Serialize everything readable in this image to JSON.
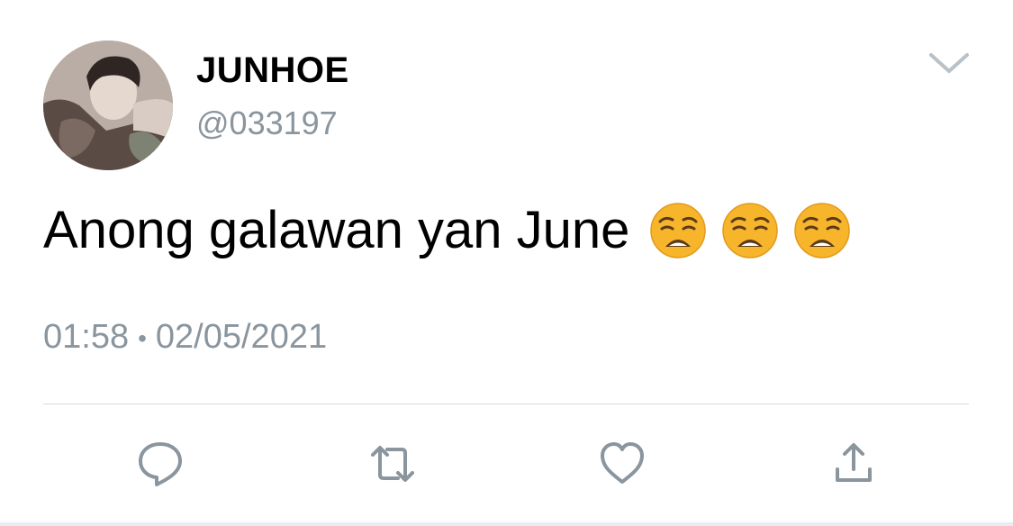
{
  "tweet": {
    "display_name": "JUNHOE",
    "handle": "@033197",
    "text": "Anong galawan yan June",
    "emojis": [
      "weary-face-emoji",
      "weary-face-emoji",
      "weary-face-emoji"
    ],
    "time": "01:58",
    "separator": "•",
    "date": "02/05/2021"
  },
  "icons": {
    "menu": "chevron-down-icon",
    "reply": "reply-icon",
    "retweet": "retweet-icon",
    "like": "heart-icon",
    "share": "share-icon"
  },
  "colors": {
    "icon": "#8a959e",
    "text": "#000000",
    "muted": "#8a959e",
    "divider": "#d7dde2",
    "emoji": "#f7b52c"
  }
}
